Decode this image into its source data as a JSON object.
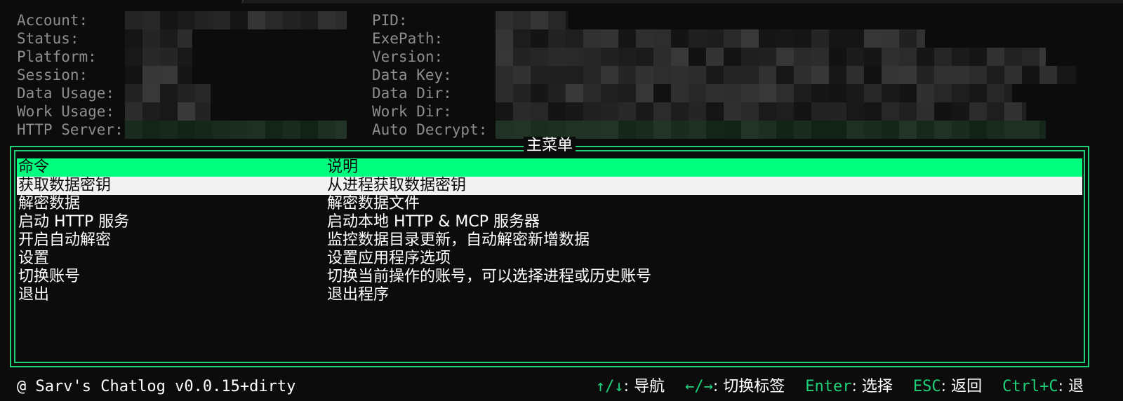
{
  "window": {
    "theme_color": "#1fd27a",
    "header_color": "#00ff7f"
  },
  "info": {
    "left": [
      {
        "label": "Account:"
      },
      {
        "label": "Status:"
      },
      {
        "label": "Platform:"
      },
      {
        "label": "Session:"
      },
      {
        "label": "Data Usage:"
      },
      {
        "label": "Work Usage:"
      },
      {
        "label": "HTTP Server:"
      }
    ],
    "right": [
      {
        "label": "PID:"
      },
      {
        "label": "ExePath:"
      },
      {
        "label": "Version:"
      },
      {
        "label": "Data Key:"
      },
      {
        "label": "Data Dir:"
      },
      {
        "label": "Work Dir:"
      },
      {
        "label": "Auto Decrypt:"
      }
    ]
  },
  "menu": {
    "title": "主菜单",
    "columns": {
      "command": "命令",
      "description": "说明"
    },
    "items": [
      {
        "command": "获取数据密钥",
        "description": "从进程获取数据密钥"
      },
      {
        "command": "解密数据",
        "description": "解密数据文件"
      },
      {
        "command": "启动 HTTP 服务",
        "description": "启动本地 HTTP & MCP 服务器"
      },
      {
        "command": "开启自动解密",
        "description": "监控数据目录更新，自动解密新增数据"
      },
      {
        "command": "设置",
        "description": "设置应用程序选项"
      },
      {
        "command": "切换账号",
        "description": "切换当前操作的账号，可以选择进程或历史账号"
      },
      {
        "command": "退出",
        "description": "退出程序"
      }
    ],
    "selected_index": 0
  },
  "status": {
    "app": "@ Sarv's Chatlog v0.0.15+dirty",
    "hints": [
      {
        "key": "↑/↓",
        "sep": ": ",
        "action": "导航"
      },
      {
        "key": "←/→",
        "sep": ": ",
        "action": "切换标签"
      },
      {
        "key": "Enter",
        "sep": ": ",
        "action": "选择"
      },
      {
        "key": "ESC",
        "sep": ": ",
        "action": "返回"
      },
      {
        "key": "Ctrl+C",
        "sep": ": ",
        "action": "退"
      }
    ]
  }
}
